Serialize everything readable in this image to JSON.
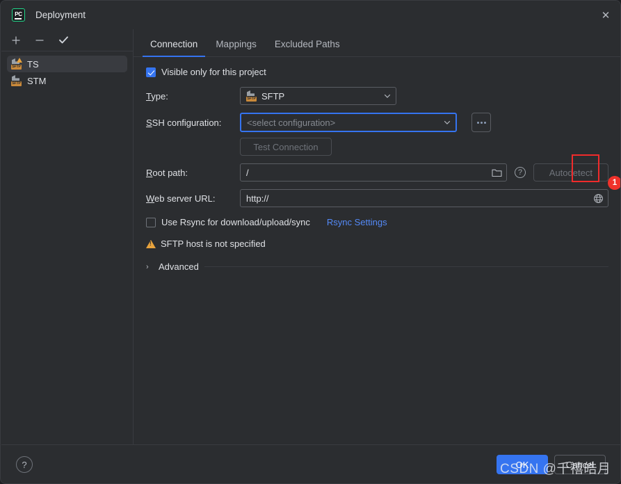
{
  "window": {
    "title": "Deployment",
    "app_icon": "pycharm-logo-icon",
    "app_icon_text": "PC",
    "close_icon": "✕"
  },
  "sidebar": {
    "toolbar": [
      {
        "name": "add-server-button",
        "glyph": "+"
      },
      {
        "name": "remove-server-button",
        "glyph": "−"
      },
      {
        "name": "set-default-button",
        "glyph": "✓"
      }
    ],
    "items": [
      {
        "label": "TS",
        "icon": "sftp-warning-icon",
        "selected": true,
        "has_warning": true
      },
      {
        "label": "STM",
        "icon": "sftp-icon",
        "selected": false,
        "has_warning": false
      }
    ]
  },
  "tabs": [
    {
      "label": "Connection",
      "active": true
    },
    {
      "label": "Mappings",
      "active": false
    },
    {
      "label": "Excluded Paths",
      "active": false
    }
  ],
  "form": {
    "visible_only_checkbox": {
      "label": "Visible only for this project",
      "checked": true
    },
    "type": {
      "label_pre": "T",
      "label_post": "ype:",
      "value": "SFTP",
      "icon": "sftp-icon"
    },
    "ssh_configuration": {
      "label_pre": "S",
      "label_post": "SH configuration:",
      "placeholder": "<select configuration>",
      "browse_button": "…"
    },
    "test_connection": {
      "label": "Test Connection",
      "enabled": false
    },
    "root_path": {
      "label_pre": "R",
      "label_post": "oot path:",
      "value": "/",
      "browse_icon": "folder-icon",
      "help_icon": "help-icon",
      "autodetect_label": "Autodetect",
      "autodetect_enabled": false
    },
    "web_server_url": {
      "label_pre": "W",
      "label_post": "eb server URL:",
      "value": "http://",
      "open_icon": "globe-icon"
    },
    "rsync": {
      "checkbox_label": "Use Rsync for download/upload/sync",
      "checked": false,
      "settings_link": "Rsync Settings"
    },
    "warning": {
      "icon": "warning-triangle-icon",
      "text": "SFTP host is not specified"
    },
    "advanced": {
      "label": "Advanced",
      "arrow": "›",
      "expanded": false
    }
  },
  "annotation": {
    "badge_number": "1",
    "box_color": "#f02b2b",
    "badge_color": "#f0322b"
  },
  "footer": {
    "help_label": "?",
    "ok_label": "OK",
    "cancel_label": "Cancel"
  },
  "watermark": {
    "text": "CSDN @千禧皓月"
  },
  "colors": {
    "accent_blue": "#3574f0",
    "link_blue": "#548af7",
    "warning_orange": "#e8a33d",
    "panel_bg": "#2b2d30",
    "selected_row": "#393b40"
  }
}
